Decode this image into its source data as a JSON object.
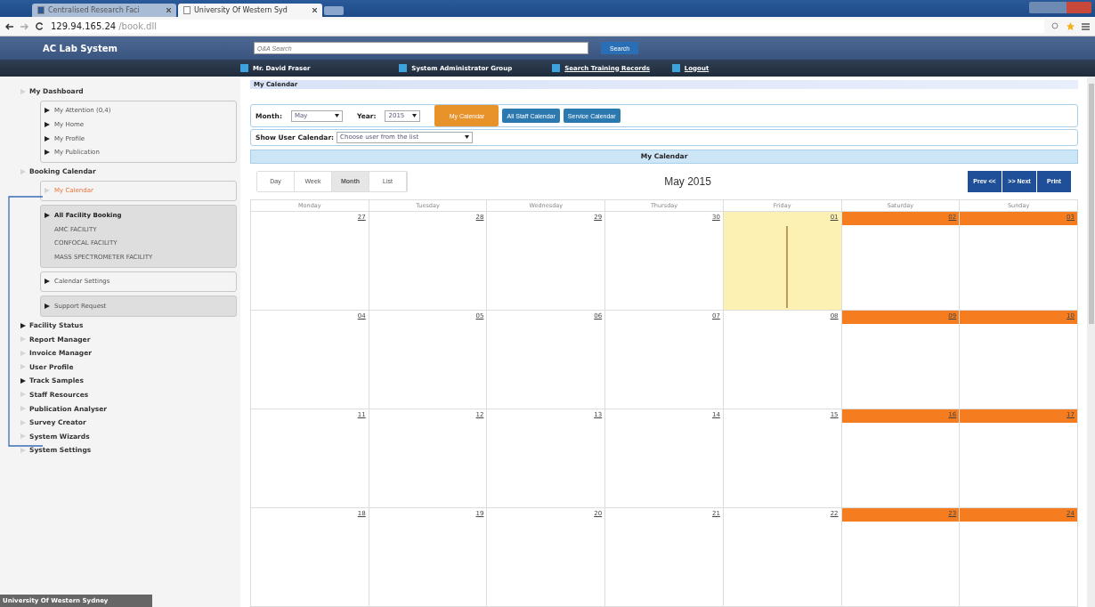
{
  "browser": {
    "tabs": [
      {
        "label": "Centralised Research Faci",
        "selected": false
      },
      {
        "label": "University Of Western Syd",
        "selected": true
      }
    ],
    "url_host": "129.94.165.24",
    "url_path": "/book.dll"
  },
  "app": {
    "title": "AC Lab System",
    "search_placeholder": "Q&A Search",
    "search_button": "Search"
  },
  "nav": [
    {
      "label": "Mr. David Fraser",
      "link": false
    },
    {
      "label": "System Administrator Group",
      "link": false
    },
    {
      "label": "Search Training Records",
      "link": true
    },
    {
      "label": "Logout",
      "link": true
    }
  ],
  "sidebar": {
    "sections": [
      {
        "label": "My Dashboard",
        "kind": "faint",
        "groups": [
          {
            "shaded": false,
            "items": [
              {
                "label": "My Attention (0,4)",
                "kind": "filled",
                "bold": false,
                "selected": false
              },
              {
                "label": "My Home",
                "kind": "filled",
                "bold": false,
                "selected": false
              },
              {
                "label": "My Profile",
                "kind": "filled",
                "bold": false,
                "selected": false
              },
              {
                "label": "My Publication",
                "kind": "filled",
                "bold": false,
                "selected": false
              }
            ]
          }
        ]
      },
      {
        "label": "Booking Calendar",
        "kind": "faint",
        "groups": [
          {
            "shaded": false,
            "items": [
              {
                "label": "My Calendar",
                "kind": "faint",
                "bold": false,
                "selected": true
              }
            ]
          },
          {
            "shaded": true,
            "items": [
              {
                "label": "All Facility Booking",
                "kind": "filled",
                "bold": true,
                "selected": false
              },
              {
                "label": "AMC FACILITY",
                "kind": "plain",
                "bold": false,
                "selected": false
              },
              {
                "label": "CONFOCAL FACILITY",
                "kind": "plain",
                "bold": false,
                "selected": false
              },
              {
                "label": "MASS SPECTROMETER FACILITY",
                "kind": "plain",
                "bold": false,
                "selected": false
              }
            ]
          },
          {
            "shaded": false,
            "items": [
              {
                "label": "Calendar Settings",
                "kind": "filled",
                "bold": false,
                "selected": false
              }
            ]
          },
          {
            "shaded": true,
            "items": [
              {
                "label": "Support Request",
                "kind": "filled",
                "bold": false,
                "selected": false
              }
            ]
          }
        ]
      },
      {
        "label": "Facility Status",
        "kind": "filled"
      },
      {
        "label": "Report Manager",
        "kind": "faint"
      },
      {
        "label": "Invoice Manager",
        "kind": "faint"
      },
      {
        "label": "User Profile",
        "kind": "faint"
      },
      {
        "label": "Track Samples",
        "kind": "filled"
      },
      {
        "label": "Staff Resources",
        "kind": "faint"
      },
      {
        "label": "Publication Analyser",
        "kind": "faint"
      },
      {
        "label": "Survey Creator",
        "kind": "faint"
      },
      {
        "label": "System Wizards",
        "kind": "faint"
      },
      {
        "label": "System Settings",
        "kind": "faint"
      }
    ],
    "footer": "University Of Western Sydney"
  },
  "page_title": "My Calendar",
  "filters": {
    "month_label": "Month:",
    "month": "May",
    "year_label": "Year:",
    "year": "2015",
    "buttons": [
      {
        "label": "My Calendar",
        "selected": true
      },
      {
        "label": "All Staff Calendar",
        "selected": false
      },
      {
        "label": "Service Calendar",
        "selected": false
      }
    ],
    "user_label": "Show User Calendar:",
    "user_placeholder": "Choose user from the list"
  },
  "calendar_header": "My Calendar",
  "views": [
    {
      "label": "Day",
      "selected": false
    },
    {
      "label": "Week",
      "selected": false
    },
    {
      "label": "Month",
      "selected": true
    },
    {
      "label": "List",
      "selected": false
    }
  ],
  "calendar_title": "May 2015",
  "nav_buttons": [
    "Prev <<",
    ">> Next",
    "Print"
  ],
  "weekdays": [
    "Monday",
    "Tuesday",
    "Wednesday",
    "Thursday",
    "Friday",
    "Saturday",
    "Sunday"
  ],
  "weeks": [
    [
      {
        "label": "27",
        "kind": "normal"
      },
      {
        "label": "28",
        "kind": "normal"
      },
      {
        "label": "29",
        "kind": "normal"
      },
      {
        "label": "30",
        "kind": "normal"
      },
      {
        "label": "01",
        "kind": "today"
      },
      {
        "label": "02",
        "kind": "weekend"
      },
      {
        "label": "03",
        "kind": "weekend"
      }
    ],
    [
      {
        "label": "04",
        "kind": "normal"
      },
      {
        "label": "05",
        "kind": "normal"
      },
      {
        "label": "06",
        "kind": "normal"
      },
      {
        "label": "07",
        "kind": "normal"
      },
      {
        "label": "08",
        "kind": "normal"
      },
      {
        "label": "09",
        "kind": "weekend"
      },
      {
        "label": "10",
        "kind": "weekend"
      }
    ],
    [
      {
        "label": "11",
        "kind": "normal"
      },
      {
        "label": "12",
        "kind": "normal"
      },
      {
        "label": "13",
        "kind": "normal"
      },
      {
        "label": "14",
        "kind": "normal"
      },
      {
        "label": "15",
        "kind": "normal"
      },
      {
        "label": "16",
        "kind": "weekend"
      },
      {
        "label": "17",
        "kind": "weekend"
      }
    ],
    [
      {
        "label": "18",
        "kind": "normal"
      },
      {
        "label": "19",
        "kind": "normal"
      },
      {
        "label": "20",
        "kind": "normal"
      },
      {
        "label": "21",
        "kind": "normal"
      },
      {
        "label": "22",
        "kind": "normal"
      },
      {
        "label": "23",
        "kind": "weekend"
      },
      {
        "label": "24",
        "kind": "weekend"
      }
    ]
  ]
}
